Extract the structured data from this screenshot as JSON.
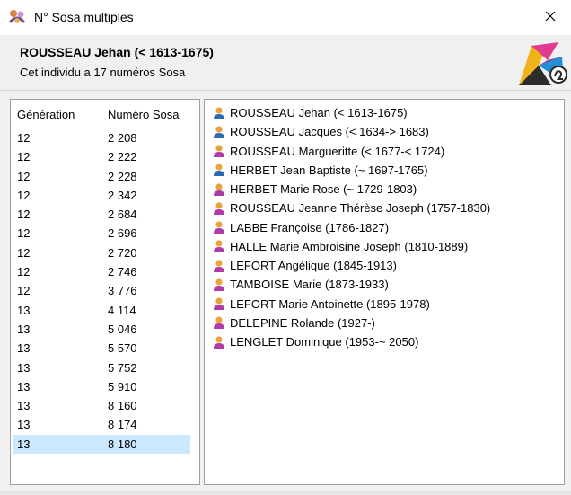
{
  "window": {
    "title": "N° Sosa multiples"
  },
  "header": {
    "name": "ROUSSEAU Jehan (< 1613-1675)",
    "subtitle": "Cet individu a 17 numéros Sosa"
  },
  "sosa_table": {
    "columns": [
      "Génération",
      "Numéro Sosa"
    ],
    "rows": [
      {
        "generation": "12",
        "sosa": "2 208"
      },
      {
        "generation": "12",
        "sosa": "2 222"
      },
      {
        "generation": "12",
        "sosa": "2 228"
      },
      {
        "generation": "12",
        "sosa": "2 342"
      },
      {
        "generation": "12",
        "sosa": "2 684"
      },
      {
        "generation": "12",
        "sosa": "2 696"
      },
      {
        "generation": "12",
        "sosa": "2 720"
      },
      {
        "generation": "12",
        "sosa": "2 746"
      },
      {
        "generation": "12",
        "sosa": "3 776"
      },
      {
        "generation": "13",
        "sosa": "4 114"
      },
      {
        "generation": "13",
        "sosa": "5 046"
      },
      {
        "generation": "13",
        "sosa": "5 570"
      },
      {
        "generation": "13",
        "sosa": "5 752"
      },
      {
        "generation": "13",
        "sosa": "5 910"
      },
      {
        "generation": "13",
        "sosa": "8 160"
      },
      {
        "generation": "13",
        "sosa": "8 174"
      },
      {
        "generation": "13",
        "sosa": "8 180"
      }
    ],
    "selected_index": 16
  },
  "lineage": [
    {
      "label": "ROUSSEAU Jehan (< 1613-1675)",
      "sex": "male"
    },
    {
      "label": "ROUSSEAU Jacques (< 1634-> 1683)",
      "sex": "male"
    },
    {
      "label": "ROUSSEAU Margueritte (< 1677-< 1724)",
      "sex": "female"
    },
    {
      "label": "HERBET Jean Baptiste (~ 1697-1765)",
      "sex": "male"
    },
    {
      "label": "HERBET Marie Rose (~ 1729-1803)",
      "sex": "female"
    },
    {
      "label": "ROUSSEAU Jeanne Thérèse Joseph (1757-1830)",
      "sex": "female"
    },
    {
      "label": "LABBE Françoise (1786-1827)",
      "sex": "female"
    },
    {
      "label": "HALLE Marie Ambroisine Joseph (1810-1889)",
      "sex": "female"
    },
    {
      "label": "LEFORT Angélique (1845-1913)",
      "sex": "female"
    },
    {
      "label": "TAMBOISE Marie (1873-1933)",
      "sex": "female"
    },
    {
      "label": "LEFORT Marie Antoinette (1895-1978)",
      "sex": "female"
    },
    {
      "label": "DELEPINE Rolande (1927-)",
      "sex": "female"
    },
    {
      "label": "LENGLET Dominique (1953-~ 2050)",
      "sex": "female"
    }
  ],
  "icons": {
    "app": "genealogy-app-icon",
    "close": "close-icon",
    "logo": "heredis-logo",
    "male": "male-person-icon",
    "female": "female-person-icon"
  },
  "colors": {
    "male_body": "#2b6cb0",
    "female_body": "#b03aa8",
    "head": "#e8a33d",
    "selection": "#cce8ff"
  }
}
